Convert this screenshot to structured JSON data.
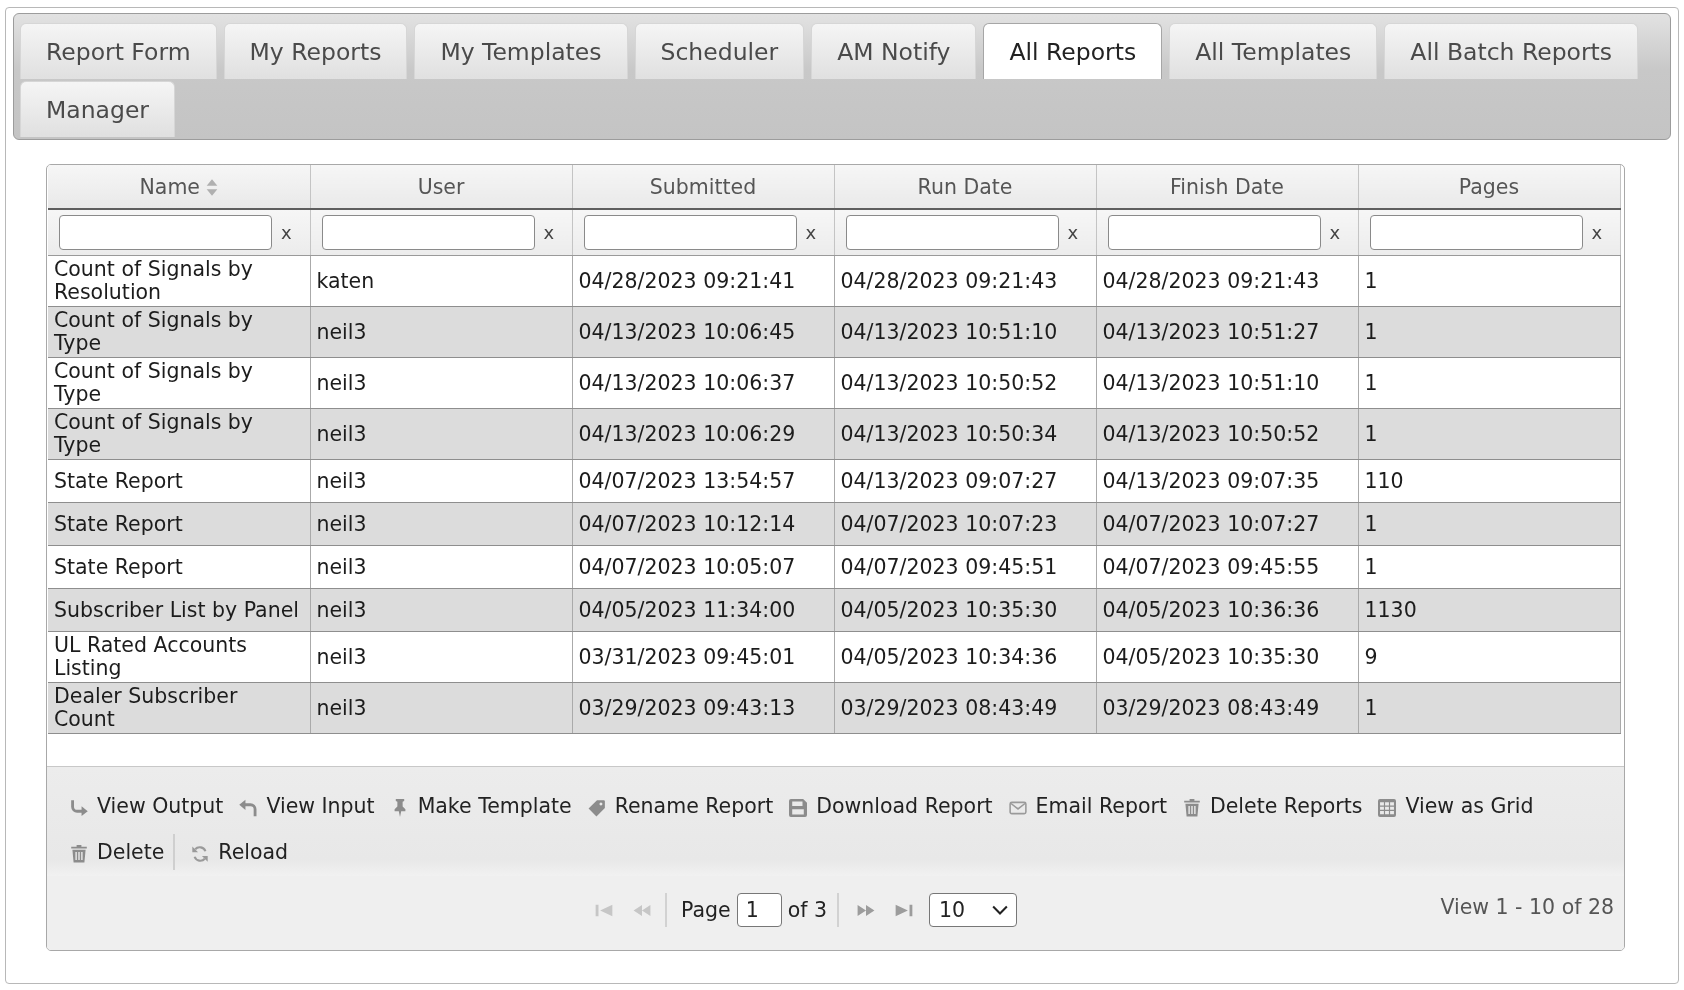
{
  "tabs": [
    {
      "label": "Report Form",
      "selected": false
    },
    {
      "label": "My Reports",
      "selected": false
    },
    {
      "label": "My Templates",
      "selected": false
    },
    {
      "label": "Scheduler",
      "selected": false
    },
    {
      "label": "AM Notify",
      "selected": false
    },
    {
      "label": "All Reports",
      "selected": true
    },
    {
      "label": "All Templates",
      "selected": false
    },
    {
      "label": "All Batch Reports",
      "selected": false
    },
    {
      "label": "Manager",
      "selected": false
    }
  ],
  "grid": {
    "columns": [
      {
        "label": "Name",
        "sorted": true,
        "filter_clear": "x"
      },
      {
        "label": "User",
        "sorted": false,
        "filter_clear": "x"
      },
      {
        "label": "Submitted",
        "sorted": false,
        "filter_clear": "x"
      },
      {
        "label": "Run Date",
        "sorted": false,
        "filter_clear": "x"
      },
      {
        "label": "Finish Date",
        "sorted": false,
        "filter_clear": "x"
      },
      {
        "label": "Pages",
        "sorted": false,
        "filter_clear": "x"
      }
    ],
    "rows": [
      [
        "Count of Signals by Resolution",
        "katen",
        "04/28/2023 09:21:41",
        "04/28/2023 09:21:43",
        "04/28/2023 09:21:43",
        "1"
      ],
      [
        "Count of Signals by Type",
        "neil3",
        "04/13/2023 10:06:45",
        "04/13/2023 10:51:10",
        "04/13/2023 10:51:27",
        "1"
      ],
      [
        "Count of Signals by Type",
        "neil3",
        "04/13/2023 10:06:37",
        "04/13/2023 10:50:52",
        "04/13/2023 10:51:10",
        "1"
      ],
      [
        "Count of Signals by Type",
        "neil3",
        "04/13/2023 10:06:29",
        "04/13/2023 10:50:34",
        "04/13/2023 10:50:52",
        "1"
      ],
      [
        "State Report",
        "neil3",
        "04/07/2023 13:54:57",
        "04/13/2023 09:07:27",
        "04/13/2023 09:07:35",
        "110"
      ],
      [
        "State Report",
        "neil3",
        "04/07/2023 10:12:14",
        "04/07/2023 10:07:23",
        "04/07/2023 10:07:27",
        "1"
      ],
      [
        "State Report",
        "neil3",
        "04/07/2023 10:05:07",
        "04/07/2023 09:45:51",
        "04/07/2023 09:45:55",
        "1"
      ],
      [
        "Subscriber List by Panel",
        "neil3",
        "04/05/2023 11:34:00",
        "04/05/2023 10:35:30",
        "04/05/2023 10:36:36",
        "1130"
      ],
      [
        "UL Rated Accounts Listing",
        "neil3",
        "03/31/2023 09:45:01",
        "04/05/2023 10:34:36",
        "04/05/2023 10:35:30",
        "9"
      ],
      [
        "Dealer Subscriber Count",
        "neil3",
        "03/29/2023 09:43:13",
        "03/29/2023 08:43:49",
        "03/29/2023 08:43:49",
        "1"
      ]
    ]
  },
  "toolbar": [
    {
      "buttons": [
        {
          "label": "View Output"
        },
        {
          "label": "View Input"
        },
        {
          "label": "Make Template"
        },
        {
          "label": "Rename Report"
        },
        {
          "label": "Download Report"
        },
        {
          "label": "Email Report"
        },
        {
          "label": "Delete Reports"
        },
        {
          "label": "View as Grid"
        },
        {
          "label": "Delete"
        }
      ]
    },
    {
      "buttons": [
        {
          "label": "Reload"
        }
      ]
    }
  ],
  "pager": {
    "back_buttons": [
      {
        "disabled": true
      },
      {
        "disabled": true
      }
    ],
    "page_label": "Page",
    "page_value": "1",
    "page_total": "of 3",
    "forward_buttons": [
      {
        "disabled": false
      },
      {
        "disabled": false
      }
    ],
    "rows_per_page": "10",
    "record_info": "View 1 - 10 of 28"
  }
}
